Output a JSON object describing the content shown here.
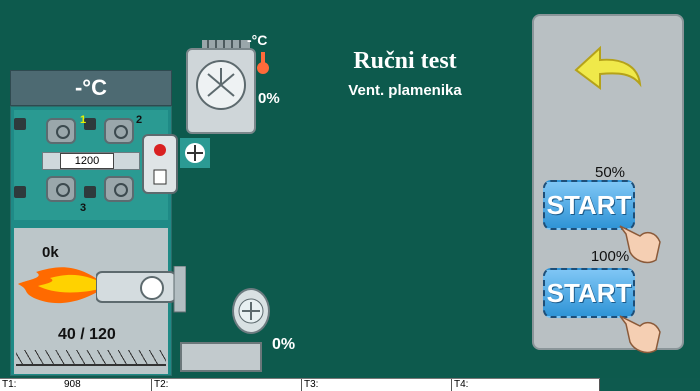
{
  "screen": {
    "title": "Ručni test",
    "subtitle": "Vent. plamenika"
  },
  "boiler": {
    "temperature": "-°C",
    "rail_value": "1200",
    "nozzle_labels": [
      "1",
      "2",
      "3"
    ],
    "power": "0k",
    "counter": "40 / 120"
  },
  "fan": {
    "temperature": "-°C",
    "percent": "0%"
  },
  "burner_fan": {
    "percent": "0%"
  },
  "panel": {
    "buttons": [
      {
        "percent_label": "50%",
        "label": "START"
      },
      {
        "percent_label": "100%",
        "label": "START"
      }
    ]
  },
  "table": {
    "cells": [
      {
        "label": "T1:",
        "value": "908"
      },
      {
        "label": "T2:",
        "value": ""
      },
      {
        "label": "T3:",
        "value": ""
      },
      {
        "label": "T4:",
        "value": ""
      }
    ]
  },
  "colors": {
    "background": "#0d5a4d",
    "button": "#2f94d6",
    "panel": "#b9c0c3",
    "nozzle_label": "#e8f200"
  }
}
